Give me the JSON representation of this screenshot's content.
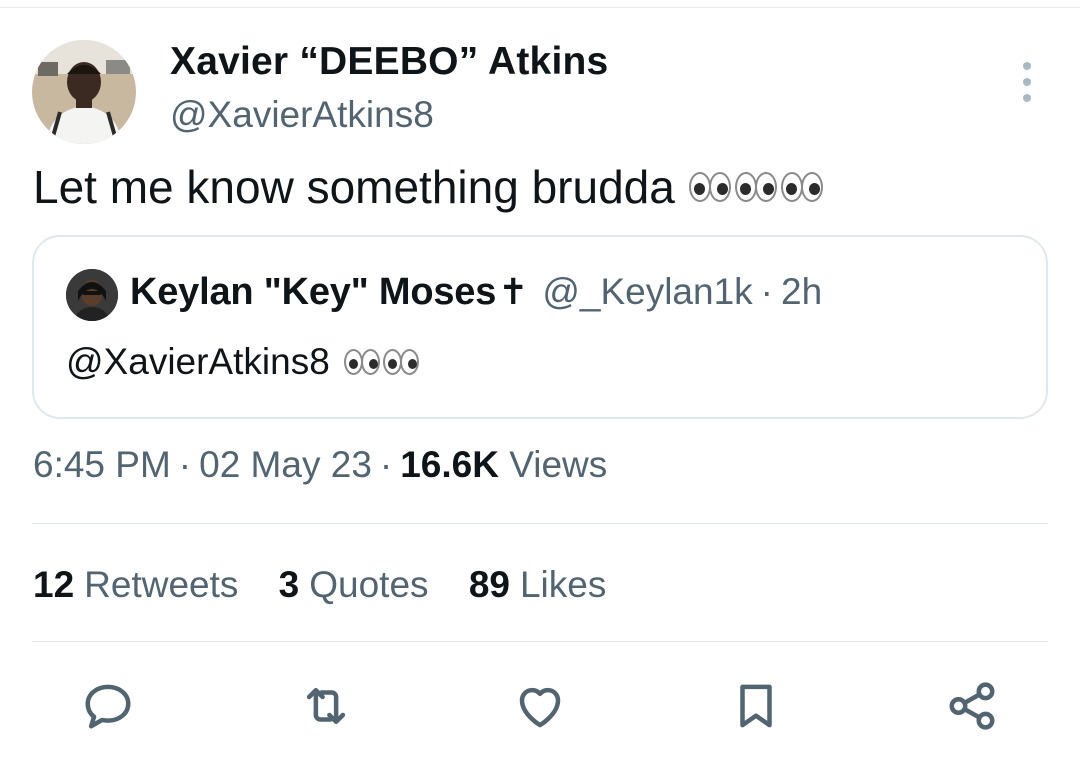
{
  "tweet": {
    "author_name": "Xavier “DEEBO” Atkins",
    "author_handle": "@XavierAtkins8",
    "text": "Let me know something brudda",
    "emoji": "eyes-emoji x3",
    "time": "6:45 PM",
    "date": "02 May 23",
    "separator": "·",
    "views_count": "16.6K",
    "views_label": "Views"
  },
  "quote": {
    "author_name": "Keylan \"Key\" Moses",
    "author_badge": "✝",
    "author_handle": "@_Keylan1k",
    "separator": "·",
    "time": "2h",
    "text": "@XavierAtkins8",
    "emoji": "eyes-emoji x2"
  },
  "stats": {
    "retweets_count": "12",
    "retweets_label": "Retweets",
    "quotes_count": "3",
    "quotes_label": "Quotes",
    "likes_count": "89",
    "likes_label": "Likes"
  },
  "actions": [
    "reply-icon",
    "retweet-icon",
    "like-icon",
    "bookmark-icon",
    "share-icon"
  ],
  "colors": {
    "text_primary": "#0f1419",
    "text_secondary": "#536471",
    "border": "#e1e8ed",
    "icon": "#536471"
  }
}
